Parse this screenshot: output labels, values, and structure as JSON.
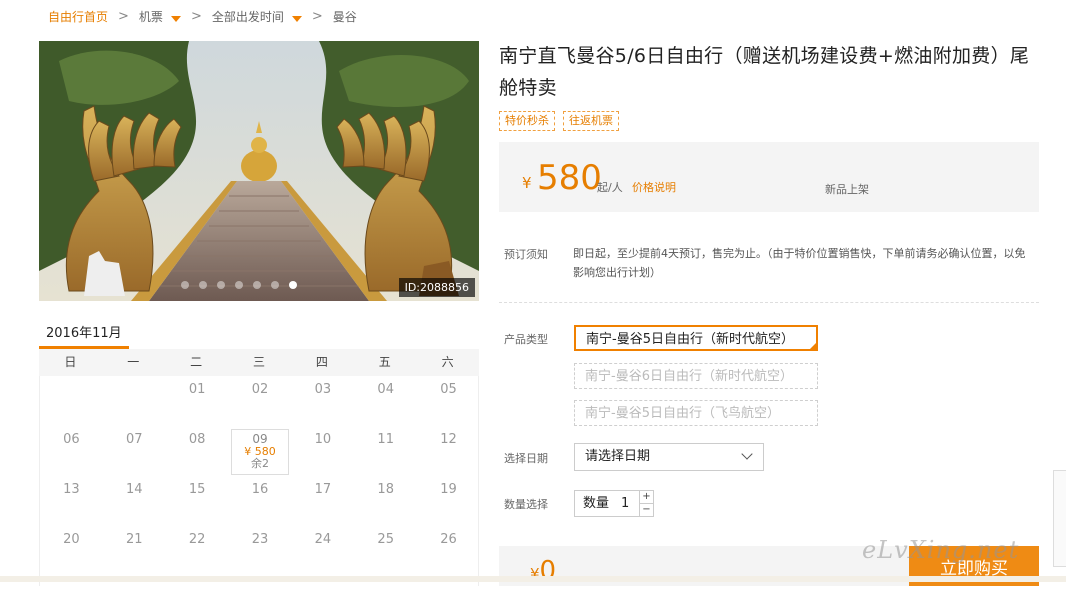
{
  "breadcrumb": {
    "home": "自由行首页",
    "items": [
      "机票",
      "全部出发时间",
      "曼谷"
    ]
  },
  "hero": {
    "image_id": "ID:2088856",
    "dots_count": 7,
    "active_dot": 6
  },
  "product": {
    "title": "南宁直飞曼谷5/6日自由行（赠送机场建设费+燃油附加费）尾舱特卖",
    "tags": [
      "特价秒杀",
      "往返机票"
    ]
  },
  "price": {
    "currency": "¥",
    "amount": "580",
    "per": "起/人",
    "explain": "价格说明",
    "status": "新品上架"
  },
  "notice": {
    "label": "预订须知",
    "text": "即日起，至少提前4天预订，售完为止。（由于特价位置销售快，下单前请务必确认位置，以免影响您出行计划）"
  },
  "product_type": {
    "label": "产品类型",
    "options": [
      "南宁-曼谷5日自由行（新时代航空）",
      "南宁-曼谷6日自由行（新时代航空）",
      "南宁-曼谷5日自由行（飞鸟航空）"
    ],
    "selected_index": 0
  },
  "date": {
    "label": "选择日期",
    "placeholder": "请选择日期"
  },
  "quantity": {
    "label": "数量选择",
    "field_label": "数量",
    "value": "1",
    "plus": "+",
    "minus": "−"
  },
  "total": {
    "currency": "¥",
    "amount": "0"
  },
  "buy_button": "立即购买",
  "watermark": "eLvXing.net",
  "calendar": {
    "month": "2016年11月",
    "weekdays": [
      "日",
      "一",
      "二",
      "三",
      "四",
      "五",
      "六"
    ],
    "rows": [
      [
        "",
        "",
        "01",
        "02",
        "03",
        "04",
        "05"
      ],
      [
        "06",
        "07",
        "08",
        "09",
        "10",
        "11",
        "12"
      ],
      [
        "13",
        "14",
        "15",
        "16",
        "17",
        "18",
        "19"
      ],
      [
        "20",
        "21",
        "22",
        "23",
        "24",
        "25",
        "26"
      ]
    ],
    "special": {
      "day": "09",
      "price": "¥ 580",
      "remain": "余2"
    }
  },
  "colors": {
    "accent": "#f08000",
    "price": "#e67e00",
    "buy": "#ef8b14"
  }
}
